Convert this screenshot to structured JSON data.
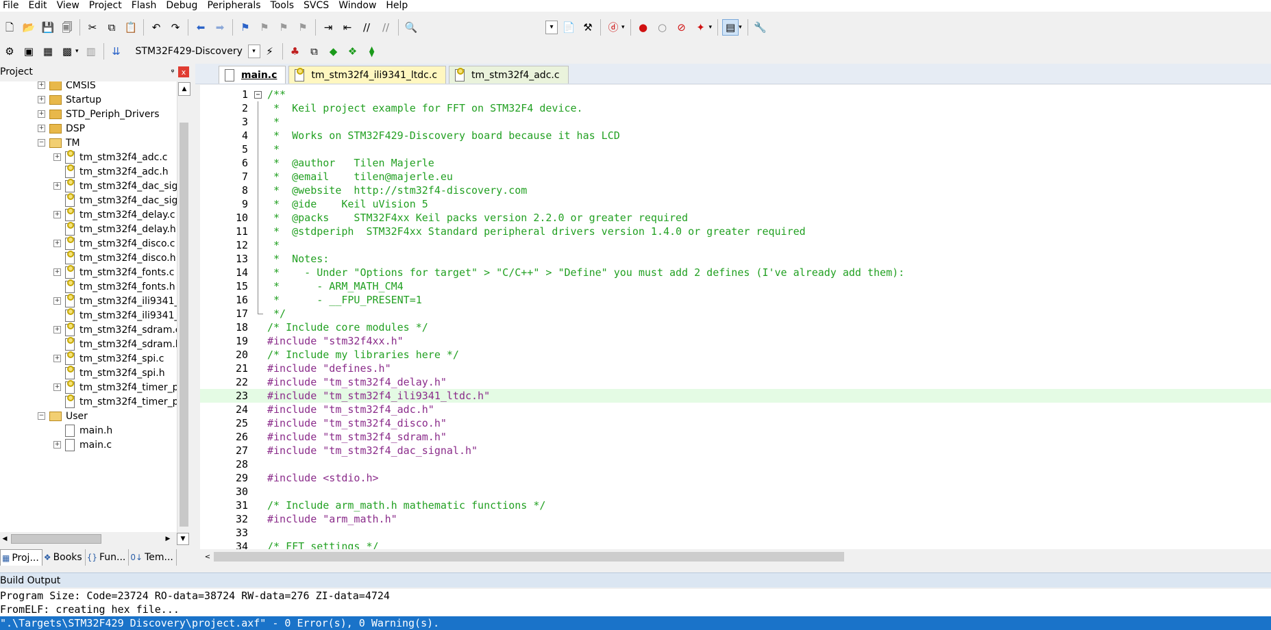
{
  "menu": [
    "File",
    "Edit",
    "View",
    "Project",
    "Flash",
    "Debug",
    "Peripherals",
    "Tools",
    "SVCS",
    "Window",
    "Help"
  ],
  "toolbar2": {
    "target": "STM32F429-Discovery"
  },
  "project_panel": {
    "title": "Project",
    "pin": "ᵠ",
    "close": "x",
    "items": [
      {
        "label": "CMSIS",
        "type": "folder",
        "indent": 1,
        "exp": "+"
      },
      {
        "label": "Startup",
        "type": "folder",
        "indent": 1,
        "exp": "+"
      },
      {
        "label": "STD_Periph_Drivers",
        "type": "folder",
        "indent": 1,
        "exp": "+"
      },
      {
        "label": "DSP",
        "type": "folder",
        "indent": 1,
        "exp": "+"
      },
      {
        "label": "TM",
        "type": "folder-open",
        "indent": 1,
        "exp": "−"
      },
      {
        "label": "tm_stm32f4_adc.c",
        "type": "file-locked",
        "indent": 2,
        "exp": "+"
      },
      {
        "label": "tm_stm32f4_adc.h",
        "type": "file-locked",
        "indent": 2,
        "exp": ""
      },
      {
        "label": "tm_stm32f4_dac_sig",
        "type": "file-locked",
        "indent": 2,
        "exp": "+"
      },
      {
        "label": "tm_stm32f4_dac_sig",
        "type": "file-locked",
        "indent": 2,
        "exp": ""
      },
      {
        "label": "tm_stm32f4_delay.c",
        "type": "file-locked",
        "indent": 2,
        "exp": "+"
      },
      {
        "label": "tm_stm32f4_delay.h",
        "type": "file-locked",
        "indent": 2,
        "exp": ""
      },
      {
        "label": "tm_stm32f4_disco.c",
        "type": "file-locked",
        "indent": 2,
        "exp": "+"
      },
      {
        "label": "tm_stm32f4_disco.h",
        "type": "file-locked",
        "indent": 2,
        "exp": ""
      },
      {
        "label": "tm_stm32f4_fonts.c",
        "type": "file-locked",
        "indent": 2,
        "exp": "+"
      },
      {
        "label": "tm_stm32f4_fonts.h",
        "type": "file-locked",
        "indent": 2,
        "exp": ""
      },
      {
        "label": "tm_stm32f4_ili9341_",
        "type": "file-locked",
        "indent": 2,
        "exp": "+"
      },
      {
        "label": "tm_stm32f4_ili9341_",
        "type": "file-locked",
        "indent": 2,
        "exp": ""
      },
      {
        "label": "tm_stm32f4_sdram.c",
        "type": "file-locked",
        "indent": 2,
        "exp": "+"
      },
      {
        "label": "tm_stm32f4_sdram.h",
        "type": "file-locked",
        "indent": 2,
        "exp": ""
      },
      {
        "label": "tm_stm32f4_spi.c",
        "type": "file-locked",
        "indent": 2,
        "exp": "+"
      },
      {
        "label": "tm_stm32f4_spi.h",
        "type": "file-locked",
        "indent": 2,
        "exp": ""
      },
      {
        "label": "tm_stm32f4_timer_p",
        "type": "file-locked",
        "indent": 2,
        "exp": "+"
      },
      {
        "label": "tm_stm32f4_timer_p",
        "type": "file-locked",
        "indent": 2,
        "exp": ""
      },
      {
        "label": "User",
        "type": "folder-open",
        "indent": 1,
        "exp": "−"
      },
      {
        "label": "main.h",
        "type": "file",
        "indent": 2,
        "exp": ""
      },
      {
        "label": "main.c",
        "type": "file",
        "indent": 2,
        "exp": "+"
      }
    ]
  },
  "panel_tabs": [
    {
      "label": "Proj...",
      "icon": "▦"
    },
    {
      "label": "Books",
      "icon": "❖"
    },
    {
      "label": "Fun...",
      "icon": "{}"
    },
    {
      "label": "Tem...",
      "icon": "0↓"
    }
  ],
  "editor_tabs": [
    {
      "label": "main.c",
      "state": "active"
    },
    {
      "label": "tm_stm32f4_ili9341_ltdc.c",
      "state": "mod"
    },
    {
      "label": "tm_stm32f4_adc.c",
      "state": "norm"
    }
  ],
  "code": [
    {
      "n": "1",
      "text": "/**",
      "kind": "comment",
      "fold": "open"
    },
    {
      "n": "2",
      "text": " *  Keil project example for FFT on STM32F4 device.",
      "kind": "comment",
      "fold": "line"
    },
    {
      "n": "3",
      "text": " *",
      "kind": "comment",
      "fold": "line"
    },
    {
      "n": "4",
      "text": " *  Works on STM32F429-Discovery board because it has LCD",
      "kind": "comment",
      "fold": "line"
    },
    {
      "n": "5",
      "text": " *",
      "kind": "comment",
      "fold": "line"
    },
    {
      "n": "6",
      "text": " *  @author   Tilen Majerle",
      "kind": "comment",
      "fold": "line"
    },
    {
      "n": "7",
      "text": " *  @email    tilen@majerle.eu",
      "kind": "comment",
      "fold": "line"
    },
    {
      "n": "8",
      "text": " *  @website  http://stm32f4-discovery.com",
      "kind": "comment",
      "fold": "line"
    },
    {
      "n": "9",
      "text": " *  @ide    Keil uVision 5",
      "kind": "comment",
      "fold": "line"
    },
    {
      "n": "10",
      "text": " *  @packs    STM32F4xx Keil packs version 2.2.0 or greater required",
      "kind": "comment",
      "fold": "line"
    },
    {
      "n": "11",
      "text": " *  @stdperiph  STM32F4xx Standard peripheral drivers version 1.4.0 or greater required",
      "kind": "comment",
      "fold": "line"
    },
    {
      "n": "12",
      "text": " *",
      "kind": "comment",
      "fold": "line"
    },
    {
      "n": "13",
      "text": " *  Notes:",
      "kind": "comment",
      "fold": "line"
    },
    {
      "n": "14",
      "text": " *    - Under \"Options for target\" > \"C/C++\" > \"Define\" you must add 2 defines (I've already add them):",
      "kind": "comment",
      "fold": "line"
    },
    {
      "n": "15",
      "text": " *      - ARM_MATH_CM4",
      "kind": "comment",
      "fold": "line"
    },
    {
      "n": "16",
      "text": " *      - __FPU_PRESENT=1",
      "kind": "comment",
      "fold": "line"
    },
    {
      "n": "17",
      "text": " */",
      "kind": "comment",
      "fold": "end"
    },
    {
      "n": "18",
      "text": "/* Include core modules */",
      "kind": "comment",
      "fold": ""
    },
    {
      "n": "19",
      "text": "#include \"stm32f4xx.h\"",
      "kind": "pp",
      "fold": ""
    },
    {
      "n": "20",
      "text": "/* Include my libraries here */",
      "kind": "comment",
      "fold": ""
    },
    {
      "n": "21",
      "text": "#include \"defines.h\"",
      "kind": "pp",
      "fold": ""
    },
    {
      "n": "22",
      "text": "#include \"tm_stm32f4_delay.h\"",
      "kind": "pp",
      "fold": ""
    },
    {
      "n": "23",
      "text": "#include \"tm_stm32f4_ili9341_ltdc.h\"",
      "kind": "pp",
      "fold": "",
      "hl": true
    },
    {
      "n": "24",
      "text": "#include \"tm_stm32f4_adc.h\"",
      "kind": "pp",
      "fold": ""
    },
    {
      "n": "25",
      "text": "#include \"tm_stm32f4_disco.h\"",
      "kind": "pp",
      "fold": ""
    },
    {
      "n": "26",
      "text": "#include \"tm_stm32f4_sdram.h\"",
      "kind": "pp",
      "fold": ""
    },
    {
      "n": "27",
      "text": "#include \"tm_stm32f4_dac_signal.h\"",
      "kind": "pp",
      "fold": ""
    },
    {
      "n": "28",
      "text": "",
      "kind": "plain",
      "fold": ""
    },
    {
      "n": "29",
      "text": "#include <stdio.h>",
      "kind": "pp",
      "fold": ""
    },
    {
      "n": "30",
      "text": "",
      "kind": "plain",
      "fold": ""
    },
    {
      "n": "31",
      "text": "/* Include arm_math.h mathematic functions */",
      "kind": "comment",
      "fold": ""
    },
    {
      "n": "32",
      "text": "#include \"arm_math.h\"",
      "kind": "pp",
      "fold": ""
    },
    {
      "n": "33",
      "text": "",
      "kind": "plain",
      "fold": ""
    },
    {
      "n": "34",
      "text": "/* FFT settings */",
      "kind": "comment",
      "fold": ""
    }
  ],
  "build_output": {
    "title": "Build Output",
    "lines": [
      {
        "text": "Program Size: Code=23724 RO-data=38724 RW-data=276 ZI-data=4724",
        "selected": false
      },
      {
        "text": "FromELF: creating hex file...",
        "selected": false
      },
      {
        "text": "\".\\Targets\\STM32F429 Discovery\\project.axf\" - 0 Error(s), 0 Warning(s).",
        "selected": true
      }
    ]
  },
  "colors": {
    "comment": "#22a022",
    "preprocessor": "#8a2b8a",
    "highlight_line": "#e4fbe4",
    "selection": "#1a73c9",
    "build_header": "#dbe6f2"
  }
}
